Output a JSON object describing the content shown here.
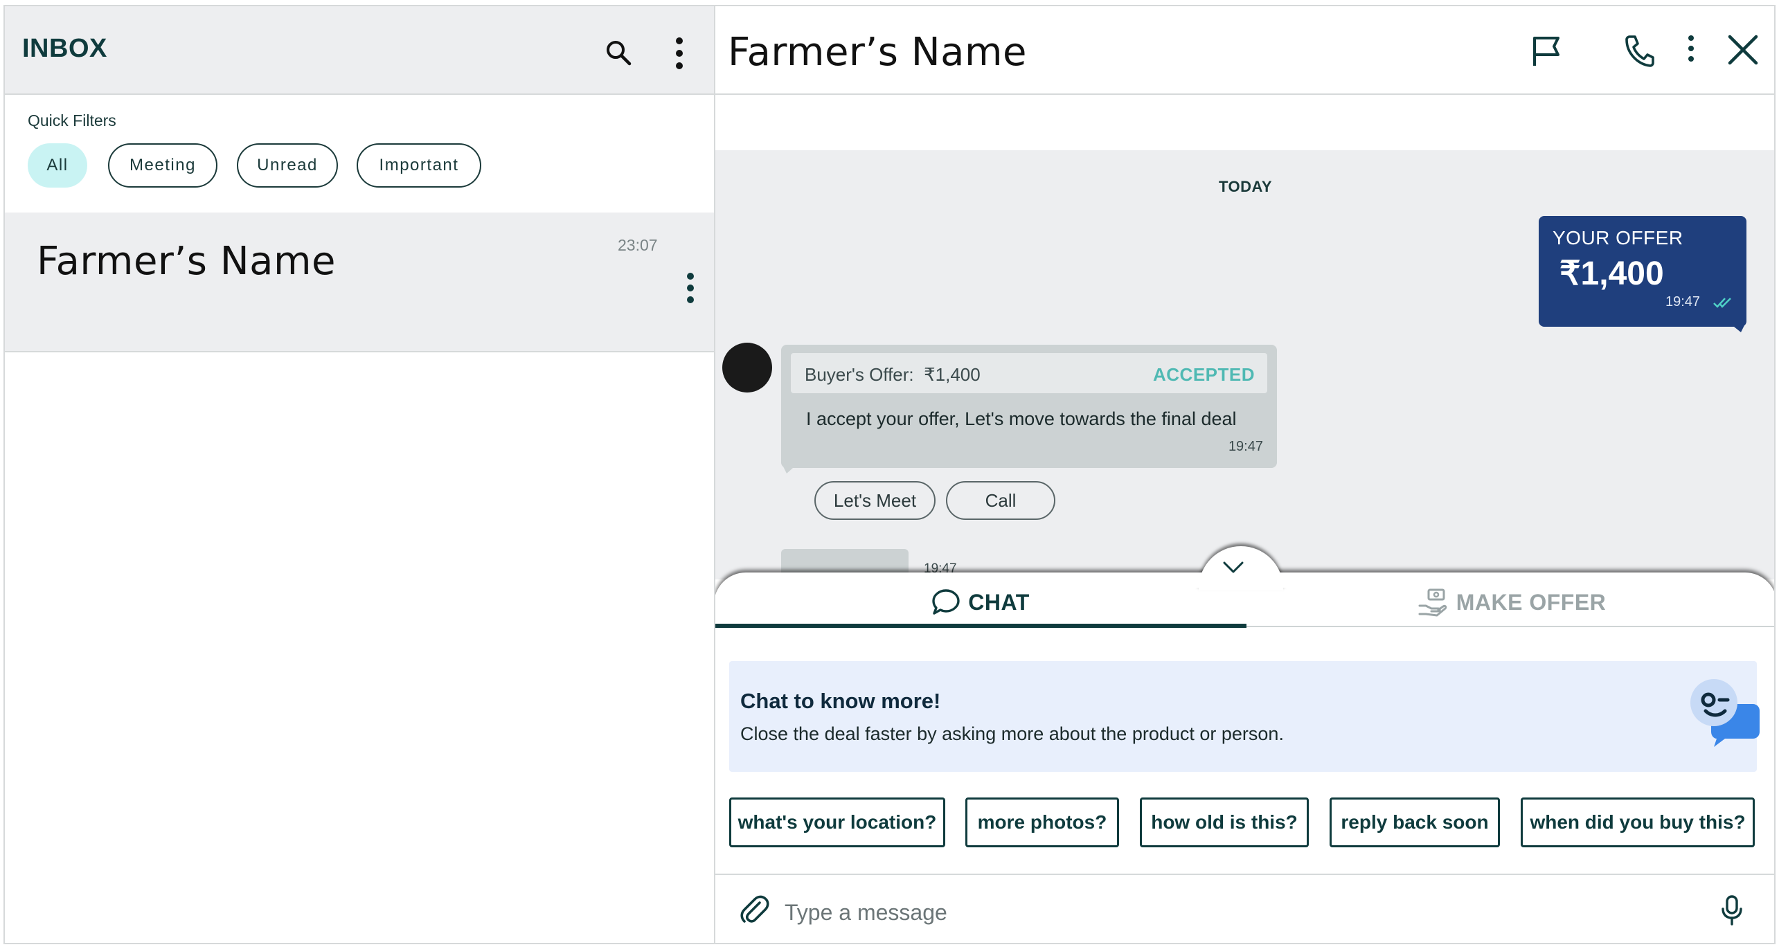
{
  "inbox": {
    "title": "INBOX",
    "search_icon": "search-icon",
    "more_icon": "more-vertical-icon"
  },
  "quick_filters": {
    "label": "Quick Filters",
    "chips": [
      "All",
      "Meeting",
      "Unread",
      "Important"
    ],
    "selected": "All"
  },
  "conversations": [
    {
      "name": "Farmer’s Name",
      "time": "23:07"
    }
  ],
  "chat": {
    "title": "Farmer’s Name",
    "header_icons": [
      "flag-icon",
      "phone-icon",
      "more-vertical-icon",
      "close-icon"
    ],
    "date_divider": "TODAY",
    "my_offer": {
      "label": "YOUR OFFER",
      "amount": "₹1,400",
      "time": "19:47"
    },
    "buyer_message": {
      "offer_text": "Buyer's Offer:  ₹1,400",
      "status": "ACCEPTED",
      "text": "I accept your offer, Let's move towards the final deal",
      "time": "19:47"
    },
    "quick_replies": [
      "Let's Meet",
      "Call"
    ],
    "partial_message_time": "19:47"
  },
  "sheet": {
    "tabs": [
      {
        "label": "CHAT",
        "icon": "chat-bubble-icon",
        "active": true
      },
      {
        "label": "MAKE OFFER",
        "icon": "hand-offer-icon",
        "active": false
      }
    ],
    "info_card": {
      "title": "Chat to know more!",
      "subtitle": "Close the deal faster by asking more about the product or person."
    },
    "suggestions": [
      "what's your location?",
      "more photos?",
      "how old is this?",
      "reply back soon",
      "when did you buy this?"
    ],
    "composer": {
      "placeholder": "Type a message",
      "value": ""
    }
  },
  "colors": {
    "primary_dark": "#0f3b3d",
    "offer_blue": "#1f3f7d",
    "accepted_teal": "#4fb9b3",
    "chip_active": "#c9f3f3",
    "chat_bg": "#edeef0",
    "info_card_bg": "#e8effc"
  }
}
